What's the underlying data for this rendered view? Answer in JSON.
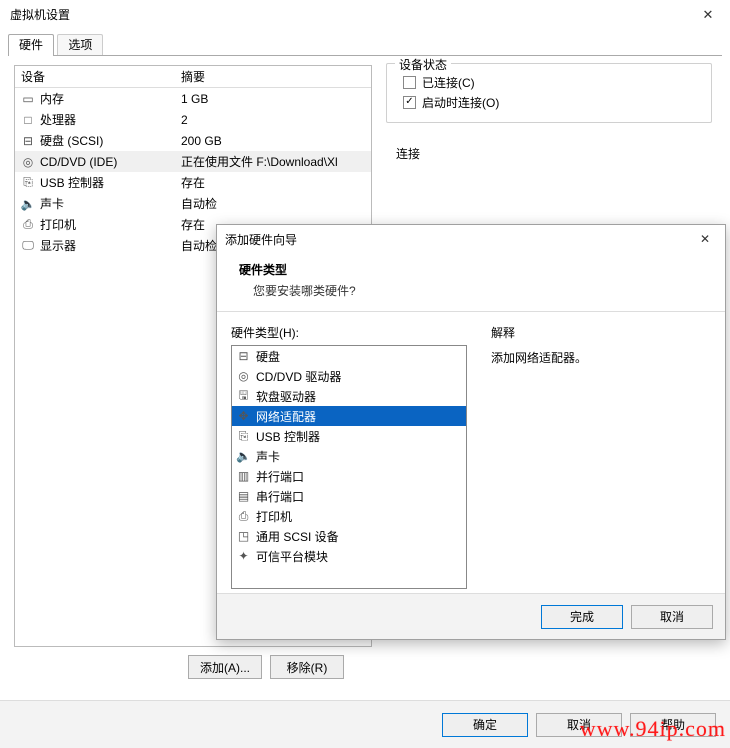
{
  "window": {
    "title": "虚拟机设置",
    "close_glyph": "✕"
  },
  "tabs": {
    "hardware": "硬件",
    "options": "选项"
  },
  "device_table": {
    "head_device": "设备",
    "head_summary": "摘要",
    "rows": [
      {
        "icon": "memory-icon",
        "glyph": "▭",
        "name": "内存",
        "summary": "1 GB",
        "selected": false
      },
      {
        "icon": "cpu-icon",
        "glyph": "□",
        "name": "处理器",
        "summary": "2",
        "selected": false
      },
      {
        "icon": "disk-icon",
        "glyph": "⊟",
        "name": "硬盘 (SCSI)",
        "summary": "200 GB",
        "selected": false
      },
      {
        "icon": "cd-icon",
        "glyph": "◎",
        "name": "CD/DVD (IDE)",
        "summary": "正在使用文件 F:\\Download\\Xl",
        "selected": true
      },
      {
        "icon": "usb-icon",
        "glyph": "⎘",
        "name": "USB 控制器",
        "summary": "存在",
        "selected": false
      },
      {
        "icon": "sound-icon",
        "glyph": "🔈",
        "name": "声卡",
        "summary": "自动检",
        "selected": false
      },
      {
        "icon": "printer-icon",
        "glyph": "⎙",
        "name": "打印机",
        "summary": "存在",
        "selected": false
      },
      {
        "icon": "display-icon",
        "glyph": "🖵",
        "name": "显示器",
        "summary": "自动检",
        "selected": false
      }
    ]
  },
  "addremove": {
    "add": "添加(A)...",
    "remove": "移除(R)"
  },
  "right_panel": {
    "status_title": "设备状态",
    "connected": "已连接(C)",
    "connect_on_power": "启动时连接(O)",
    "connection_title": "连接"
  },
  "wizard": {
    "title": "添加硬件向导",
    "close_glyph": "✕",
    "heading": "硬件类型",
    "sub": "您要安装哪类硬件?",
    "list_label": "硬件类型(H):",
    "explain_label": "解释",
    "explain_text": "添加网络适配器。",
    "items": [
      {
        "icon": "disk-icon",
        "glyph": "⊟",
        "label": "硬盘",
        "selected": false
      },
      {
        "icon": "cd-icon",
        "glyph": "◎",
        "label": "CD/DVD 驱动器",
        "selected": false
      },
      {
        "icon": "floppy-icon",
        "glyph": "🖫",
        "label": "软盘驱动器",
        "selected": false
      },
      {
        "icon": "network-icon",
        "glyph": "✥",
        "label": "网络适配器",
        "selected": true
      },
      {
        "icon": "usb-icon",
        "glyph": "⎘",
        "label": "USB 控制器",
        "selected": false
      },
      {
        "icon": "sound-icon",
        "glyph": "🔈",
        "label": "声卡",
        "selected": false
      },
      {
        "icon": "parallel-icon",
        "glyph": "▥",
        "label": "并行端口",
        "selected": false
      },
      {
        "icon": "serial-icon",
        "glyph": "▤",
        "label": "串行端口",
        "selected": false
      },
      {
        "icon": "printer-icon",
        "glyph": "⎙",
        "label": "打印机",
        "selected": false
      },
      {
        "icon": "scsi-icon",
        "glyph": "◳",
        "label": "通用 SCSI 设备",
        "selected": false
      },
      {
        "icon": "tpm-icon",
        "glyph": "✦",
        "label": "可信平台模块",
        "selected": false
      }
    ],
    "finish": "完成",
    "cancel": "取消"
  },
  "footer": {
    "ok": "确定",
    "cancel": "取消",
    "help": "帮助"
  },
  "watermark": "www.94ip.com"
}
